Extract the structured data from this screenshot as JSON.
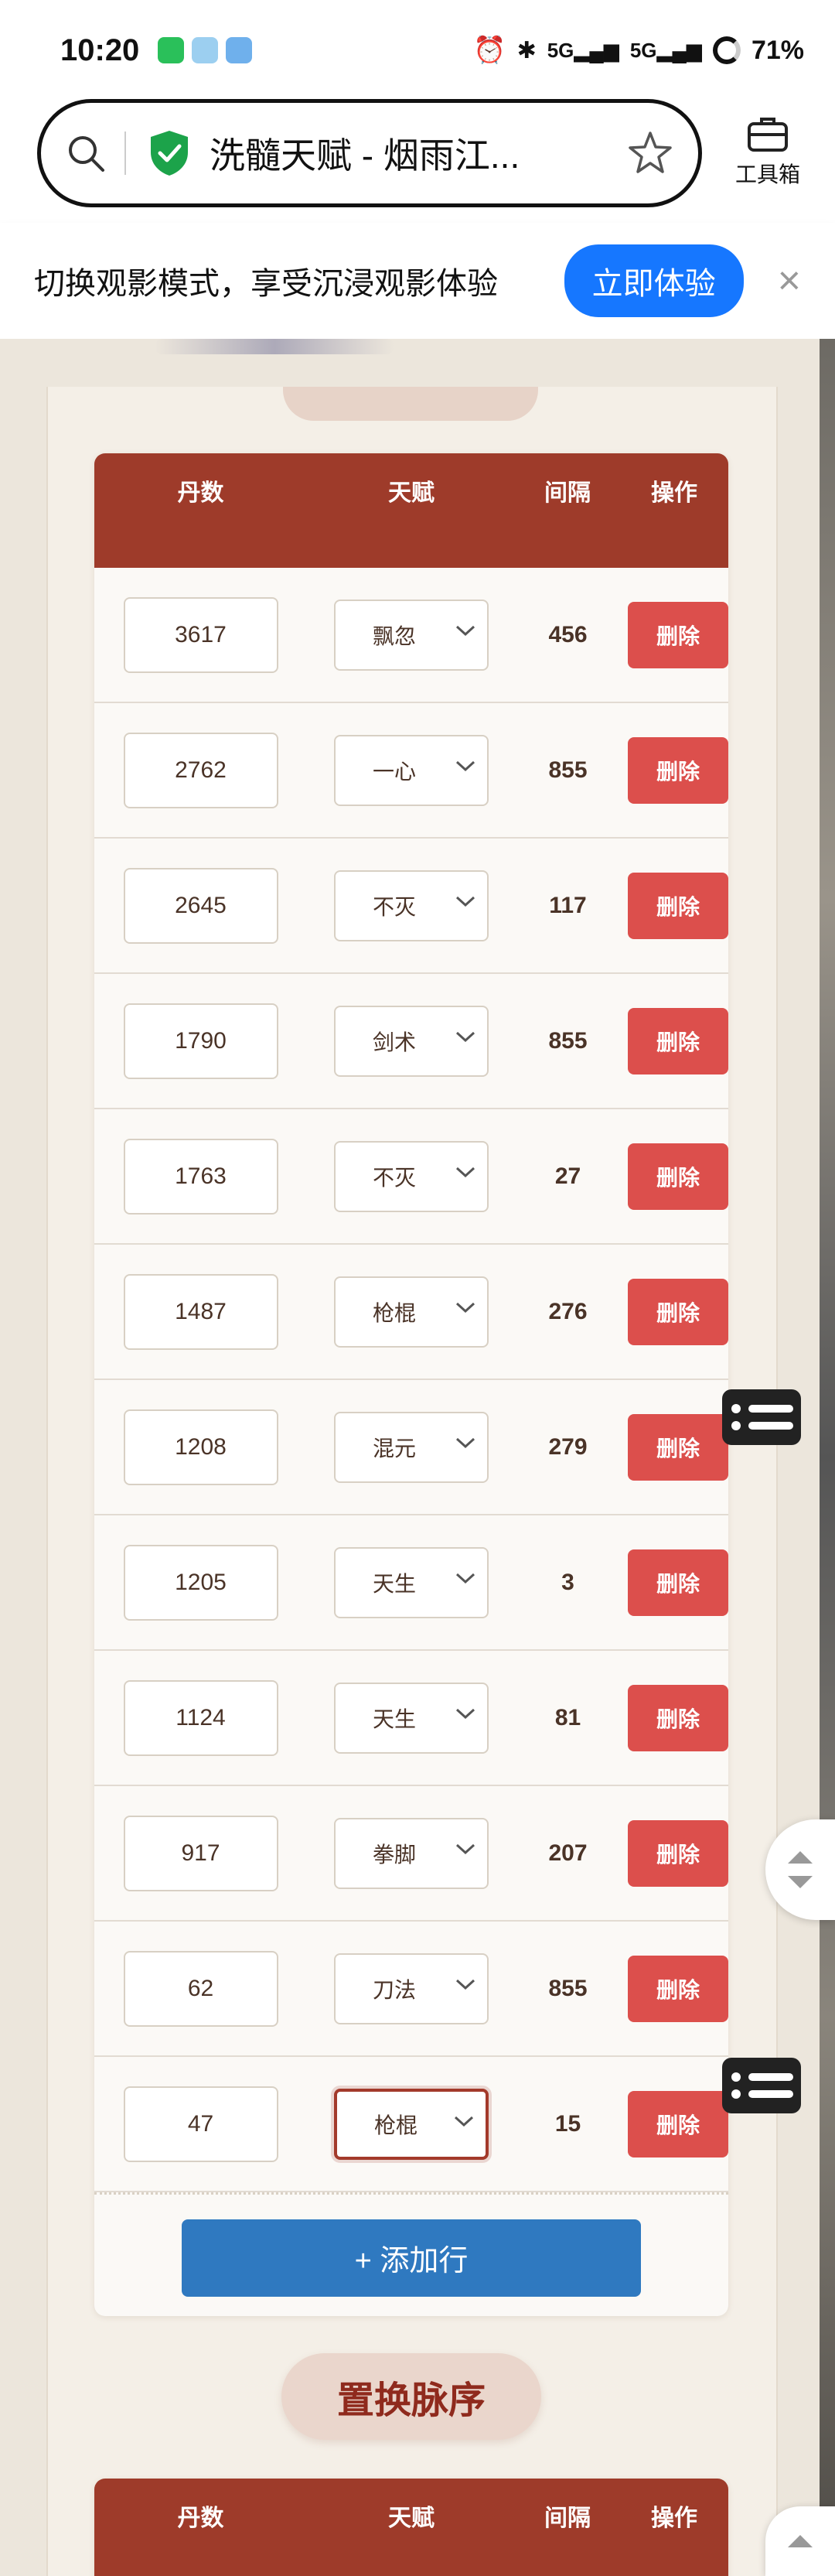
{
  "status_bar": {
    "time": "10:20",
    "signal_1": "5G",
    "signal_2": "5G",
    "battery": "71%"
  },
  "browser": {
    "page_title": "洗髓天赋 - 烟雨江...",
    "toolbox_label": "工具箱"
  },
  "banner": {
    "text": "切换观影模式，享受沉浸观影体验",
    "button": "立即体验",
    "close": "×"
  },
  "table1": {
    "headers": {
      "dan": "丹数",
      "talent": "天赋",
      "interval": "间隔",
      "action": "操作"
    },
    "rows": [
      {
        "dan": "3617",
        "talent": "飘忽",
        "interval": "456",
        "del": "删除"
      },
      {
        "dan": "2762",
        "talent": "一心",
        "interval": "855",
        "del": "删除"
      },
      {
        "dan": "2645",
        "talent": "不灭",
        "interval": "117",
        "del": "删除"
      },
      {
        "dan": "1790",
        "talent": "剑术",
        "interval": "855",
        "del": "删除"
      },
      {
        "dan": "1763",
        "talent": "不灭",
        "interval": "27",
        "del": "删除"
      },
      {
        "dan": "1487",
        "talent": "枪棍",
        "interval": "276",
        "del": "删除"
      },
      {
        "dan": "1208",
        "talent": "混元",
        "interval": "279",
        "del": "删除"
      },
      {
        "dan": "1205",
        "talent": "天生",
        "interval": "3",
        "del": "删除"
      },
      {
        "dan": "1124",
        "talent": "天生",
        "interval": "81",
        "del": "删除"
      },
      {
        "dan": "917",
        "talent": "拳脚",
        "interval": "207",
        "del": "删除"
      },
      {
        "dan": "62",
        "talent": "刀法",
        "interval": "855",
        "del": "删除"
      },
      {
        "dan": "47",
        "talent": "枪棍",
        "interval": "15",
        "del": "删除"
      }
    ],
    "add_row": "+ 添加行"
  },
  "section2": {
    "title": "置换脉序",
    "headers": {
      "dan": "丹数",
      "talent": "天赋",
      "interval": "间隔",
      "action": "操作"
    }
  },
  "colors": {
    "header_red": "#9e3b2a",
    "delete_red": "#dc4f4c",
    "add_blue": "#2f79c0",
    "banner_blue": "#1677ff"
  }
}
